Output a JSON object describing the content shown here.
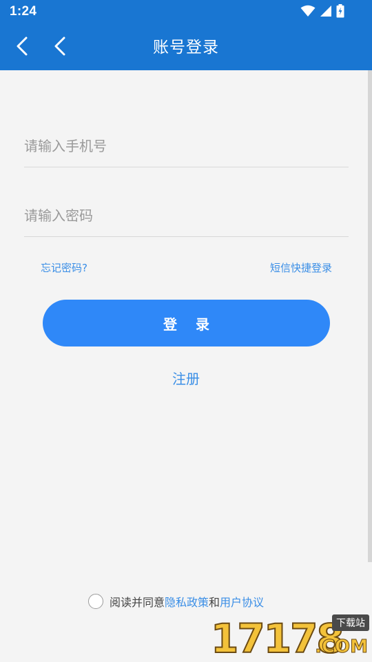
{
  "status_bar": {
    "time": "1:24",
    "icons": [
      "wifi-icon",
      "signal-icon",
      "battery-charging-icon"
    ]
  },
  "app_bar": {
    "title": "账号登录",
    "back_icon": "chevron-left-icon"
  },
  "form": {
    "phone_placeholder": "请输入手机号",
    "password_placeholder": "请输入密码",
    "forgot_password": "忘记密码?",
    "sms_login": "短信快捷登录",
    "login_button": "登 录",
    "register": "注册"
  },
  "agreement": {
    "prefix": "阅读并同意",
    "privacy_policy": "隐私政策",
    "and": "和",
    "user_agreement": "用户协议"
  },
  "watermark": {
    "digits": "17178",
    "badge": "下载站",
    "suffix": ".COM"
  },
  "colors": {
    "primary": "#1976d2",
    "button": "#2f88f8",
    "link": "#3a8ee6",
    "background": "#f4f4f4"
  }
}
